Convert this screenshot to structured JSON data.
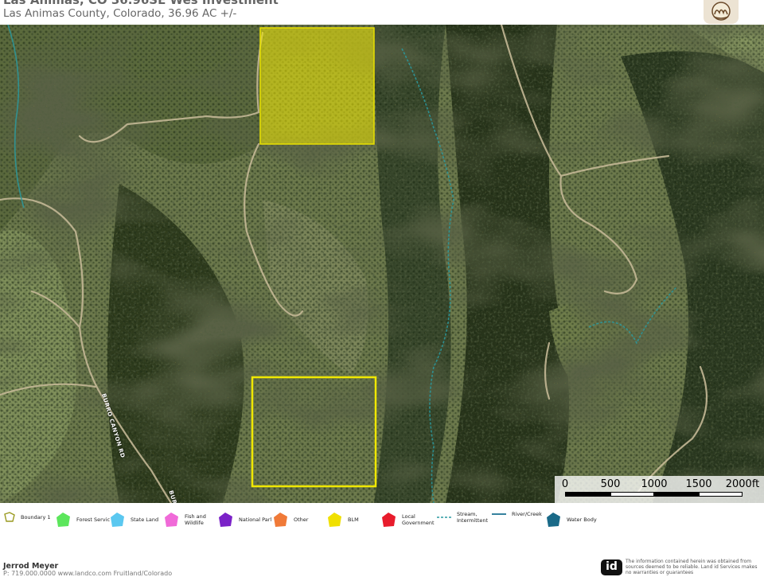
{
  "header": {
    "title": "Las Animas, CO 36.96SE Wes Investment",
    "subtitle": "Las Animas County, Colorado, 36.96 AC +/-",
    "logo_icon": "company-logo"
  },
  "map": {
    "road_labels": [
      "BURRO CANYON RD",
      "BUR"
    ],
    "scale": {
      "labels": [
        "0",
        "500",
        "1000",
        "1500",
        "2000ft"
      ]
    },
    "colors": {
      "subject_boundary": "#f0e800",
      "blm": "#f0e800",
      "stream": "#2a9aa0"
    }
  },
  "legend": {
    "items": [
      {
        "label": "Boundary 1",
        "color": "#f0e800",
        "icon": "outline-pentagon-icon"
      },
      {
        "label": "Forest Servic",
        "color": "#5ce65c",
        "icon": "pentagon-icon"
      },
      {
        "label": "State Land",
        "color": "#5bc8f0",
        "icon": "pentagon-icon"
      },
      {
        "label": "Fish and Wildlife",
        "color": "#f06ad8",
        "icon": "pentagon-icon"
      },
      {
        "label": "National Parl",
        "color": "#7b22c8",
        "icon": "pentagon-icon"
      },
      {
        "label": "Other",
        "color": "#f07a38",
        "icon": "pentagon-icon"
      },
      {
        "label": "BLM",
        "color": "#f0e000",
        "icon": "pentagon-icon"
      },
      {
        "label": "Local Government",
        "color": "#e81c2c",
        "icon": "pentagon-icon"
      },
      {
        "label": "Stream, Intermittent",
        "color": "#2a9aa0",
        "icon": "dashed-line-icon"
      },
      {
        "label": "River/Creek",
        "color": "#1a7090",
        "icon": "line-icon"
      },
      {
        "label": "Water Body",
        "color": "#1a6a88",
        "icon": "pentagon-icon"
      }
    ]
  },
  "footer": {
    "agent_name": "Jerrod Meyer",
    "contact": "P: 719.000.0000   www.landco.com   Fruitland/Colorado",
    "logo_text": "id",
    "disclaimer": "The information contained herein was obtained from sources deemed to be reliable. Land id Services makes no warranties or guarantees"
  }
}
